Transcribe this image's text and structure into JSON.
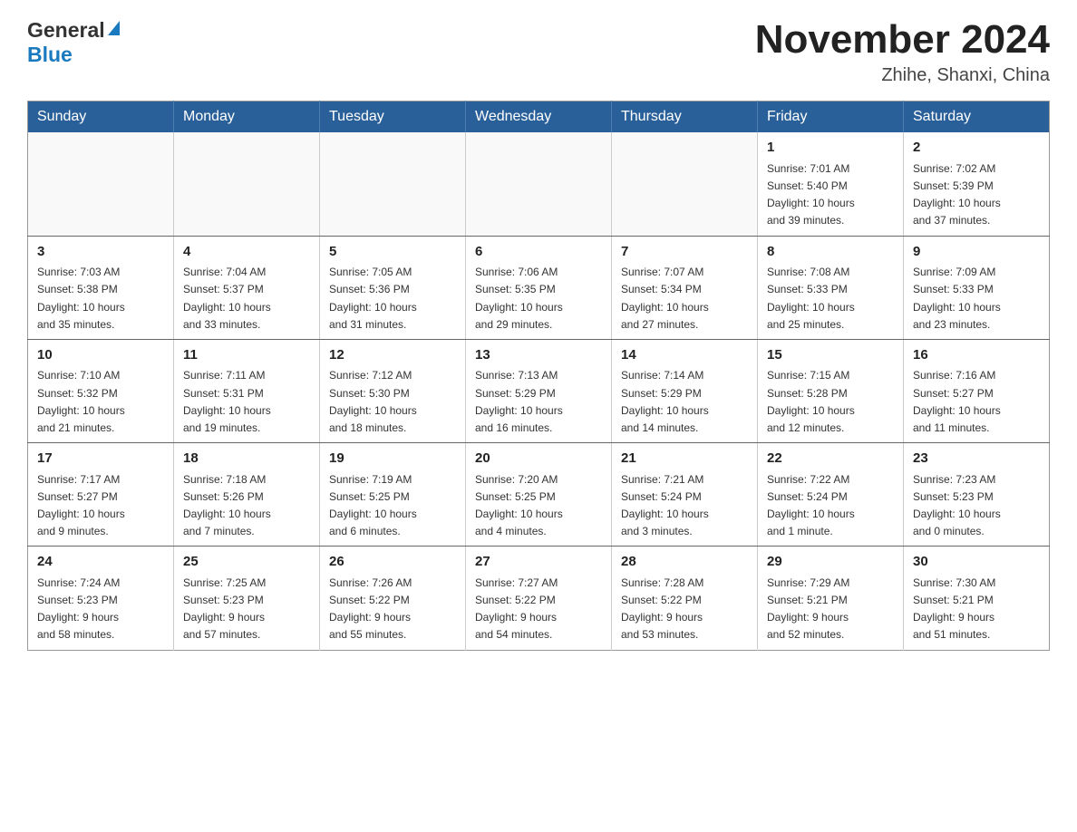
{
  "logo": {
    "line1": "General",
    "line2": "Blue"
  },
  "header": {
    "title": "November 2024",
    "subtitle": "Zhihe, Shanxi, China"
  },
  "weekdays": [
    "Sunday",
    "Monday",
    "Tuesday",
    "Wednesday",
    "Thursday",
    "Friday",
    "Saturday"
  ],
  "weeks": [
    [
      {
        "day": "",
        "info": ""
      },
      {
        "day": "",
        "info": ""
      },
      {
        "day": "",
        "info": ""
      },
      {
        "day": "",
        "info": ""
      },
      {
        "day": "",
        "info": ""
      },
      {
        "day": "1",
        "info": "Sunrise: 7:01 AM\nSunset: 5:40 PM\nDaylight: 10 hours\nand 39 minutes."
      },
      {
        "day": "2",
        "info": "Sunrise: 7:02 AM\nSunset: 5:39 PM\nDaylight: 10 hours\nand 37 minutes."
      }
    ],
    [
      {
        "day": "3",
        "info": "Sunrise: 7:03 AM\nSunset: 5:38 PM\nDaylight: 10 hours\nand 35 minutes."
      },
      {
        "day": "4",
        "info": "Sunrise: 7:04 AM\nSunset: 5:37 PM\nDaylight: 10 hours\nand 33 minutes."
      },
      {
        "day": "5",
        "info": "Sunrise: 7:05 AM\nSunset: 5:36 PM\nDaylight: 10 hours\nand 31 minutes."
      },
      {
        "day": "6",
        "info": "Sunrise: 7:06 AM\nSunset: 5:35 PM\nDaylight: 10 hours\nand 29 minutes."
      },
      {
        "day": "7",
        "info": "Sunrise: 7:07 AM\nSunset: 5:34 PM\nDaylight: 10 hours\nand 27 minutes."
      },
      {
        "day": "8",
        "info": "Sunrise: 7:08 AM\nSunset: 5:33 PM\nDaylight: 10 hours\nand 25 minutes."
      },
      {
        "day": "9",
        "info": "Sunrise: 7:09 AM\nSunset: 5:33 PM\nDaylight: 10 hours\nand 23 minutes."
      }
    ],
    [
      {
        "day": "10",
        "info": "Sunrise: 7:10 AM\nSunset: 5:32 PM\nDaylight: 10 hours\nand 21 minutes."
      },
      {
        "day": "11",
        "info": "Sunrise: 7:11 AM\nSunset: 5:31 PM\nDaylight: 10 hours\nand 19 minutes."
      },
      {
        "day": "12",
        "info": "Sunrise: 7:12 AM\nSunset: 5:30 PM\nDaylight: 10 hours\nand 18 minutes."
      },
      {
        "day": "13",
        "info": "Sunrise: 7:13 AM\nSunset: 5:29 PM\nDaylight: 10 hours\nand 16 minutes."
      },
      {
        "day": "14",
        "info": "Sunrise: 7:14 AM\nSunset: 5:29 PM\nDaylight: 10 hours\nand 14 minutes."
      },
      {
        "day": "15",
        "info": "Sunrise: 7:15 AM\nSunset: 5:28 PM\nDaylight: 10 hours\nand 12 minutes."
      },
      {
        "day": "16",
        "info": "Sunrise: 7:16 AM\nSunset: 5:27 PM\nDaylight: 10 hours\nand 11 minutes."
      }
    ],
    [
      {
        "day": "17",
        "info": "Sunrise: 7:17 AM\nSunset: 5:27 PM\nDaylight: 10 hours\nand 9 minutes."
      },
      {
        "day": "18",
        "info": "Sunrise: 7:18 AM\nSunset: 5:26 PM\nDaylight: 10 hours\nand 7 minutes."
      },
      {
        "day": "19",
        "info": "Sunrise: 7:19 AM\nSunset: 5:25 PM\nDaylight: 10 hours\nand 6 minutes."
      },
      {
        "day": "20",
        "info": "Sunrise: 7:20 AM\nSunset: 5:25 PM\nDaylight: 10 hours\nand 4 minutes."
      },
      {
        "day": "21",
        "info": "Sunrise: 7:21 AM\nSunset: 5:24 PM\nDaylight: 10 hours\nand 3 minutes."
      },
      {
        "day": "22",
        "info": "Sunrise: 7:22 AM\nSunset: 5:24 PM\nDaylight: 10 hours\nand 1 minute."
      },
      {
        "day": "23",
        "info": "Sunrise: 7:23 AM\nSunset: 5:23 PM\nDaylight: 10 hours\nand 0 minutes."
      }
    ],
    [
      {
        "day": "24",
        "info": "Sunrise: 7:24 AM\nSunset: 5:23 PM\nDaylight: 9 hours\nand 58 minutes."
      },
      {
        "day": "25",
        "info": "Sunrise: 7:25 AM\nSunset: 5:23 PM\nDaylight: 9 hours\nand 57 minutes."
      },
      {
        "day": "26",
        "info": "Sunrise: 7:26 AM\nSunset: 5:22 PM\nDaylight: 9 hours\nand 55 minutes."
      },
      {
        "day": "27",
        "info": "Sunrise: 7:27 AM\nSunset: 5:22 PM\nDaylight: 9 hours\nand 54 minutes."
      },
      {
        "day": "28",
        "info": "Sunrise: 7:28 AM\nSunset: 5:22 PM\nDaylight: 9 hours\nand 53 minutes."
      },
      {
        "day": "29",
        "info": "Sunrise: 7:29 AM\nSunset: 5:21 PM\nDaylight: 9 hours\nand 52 minutes."
      },
      {
        "day": "30",
        "info": "Sunrise: 7:30 AM\nSunset: 5:21 PM\nDaylight: 9 hours\nand 51 minutes."
      }
    ]
  ]
}
